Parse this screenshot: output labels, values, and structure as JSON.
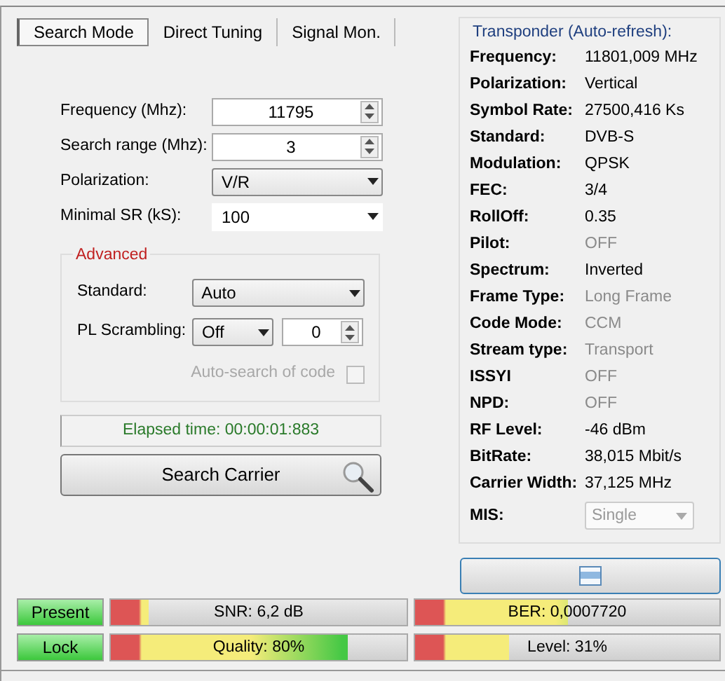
{
  "tabs": [
    {
      "label": "Search Mode",
      "selected": true
    },
    {
      "label": "Direct Tuning",
      "selected": false
    },
    {
      "label": "Signal Mon.",
      "selected": false
    }
  ],
  "search": {
    "fields": [
      {
        "kind": "spin",
        "label": "Frequency (Mhz):",
        "value": "11795"
      },
      {
        "kind": "spin",
        "label": "Search range (Mhz):",
        "value": "3"
      },
      {
        "kind": "select",
        "label": "Polarization:",
        "value": "V/R"
      },
      {
        "kind": "combo",
        "label": "Minimal SR (kS):",
        "value": "100"
      }
    ]
  },
  "advanced": {
    "title": "Advanced",
    "standard": {
      "label": "Standard:",
      "value": "Auto"
    },
    "pl_scrambling": {
      "label": "PL Scrambling:",
      "mode": "Off",
      "code": "0"
    },
    "auto_search": {
      "label": "Auto-search of code",
      "checked": false,
      "disabled": true
    }
  },
  "elapsed": "Elapsed time: 00:00:01:883",
  "search_button": "Search Carrier",
  "transponder": {
    "title": "Transponder (Auto-refresh):",
    "rows": [
      {
        "label": "Frequency:",
        "value": "11801,009 MHz",
        "disabled": false
      },
      {
        "label": "Polarization:",
        "value": "Vertical",
        "disabled": false
      },
      {
        "label": "Symbol Rate:",
        "value": "27500,416 Ks",
        "disabled": false
      },
      {
        "label": "Standard:",
        "value": "DVB-S",
        "disabled": false
      },
      {
        "label": "Modulation:",
        "value": "QPSK",
        "disabled": false
      },
      {
        "label": "FEC:",
        "value": "3/4",
        "disabled": false
      },
      {
        "label": "RollOff:",
        "value": "0.35",
        "disabled": false
      },
      {
        "label": "Pilot:",
        "value": "OFF",
        "disabled": true
      },
      {
        "label": "Spectrum:",
        "value": "Inverted",
        "disabled": false
      },
      {
        "label": "Frame Type:",
        "value": "Long Frame",
        "disabled": true
      },
      {
        "label": "Code Mode:",
        "value": "CCM",
        "disabled": true
      },
      {
        "label": "Stream type:",
        "value": "Transport",
        "disabled": true
      },
      {
        "label": "ISSYI",
        "value": "OFF",
        "disabled": true
      },
      {
        "label": "NPD:",
        "value": "OFF",
        "disabled": true
      },
      {
        "label": "RF Level:",
        "value": "-46 dBm",
        "disabled": false
      },
      {
        "label": "BitRate:",
        "value": "38,015 Mbit/s",
        "disabled": false
      },
      {
        "label": "Carrier Width:",
        "value": "37,125 MHz",
        "disabled": false
      }
    ],
    "mis": {
      "label": "MIS:",
      "value": "Single",
      "disabled": true
    }
  },
  "status": [
    {
      "indicator": {
        "label": "Present",
        "on": true
      },
      "meters": [
        {
          "label": "SNR: 6,2 dB",
          "level": 0.13
        },
        {
          "label": "BER: 0,0007720",
          "level": 0.5
        }
      ]
    },
    {
      "indicator": {
        "label": "Lock",
        "on": true
      },
      "meters": [
        {
          "label": "Quality: 80%",
          "level": 0.8
        },
        {
          "label": "Level: 31%",
          "level": 0.31
        }
      ]
    }
  ]
}
